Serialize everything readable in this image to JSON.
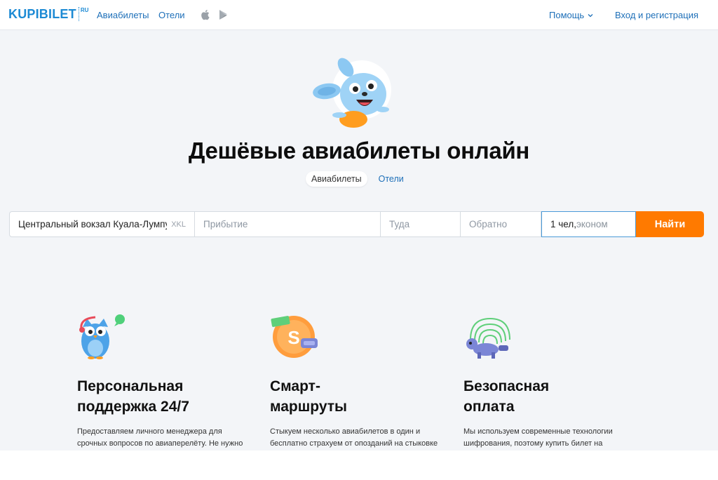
{
  "header": {
    "logo": "KUPIBILET",
    "logo_suffix": "RU",
    "nav": [
      {
        "label": "Авиабилеты"
      },
      {
        "label": "Отели"
      }
    ],
    "help_label": "Помощь",
    "login_label": "Вход и регистрация"
  },
  "hero": {
    "title": "Дешёвые авиабилеты онлайн",
    "tabs": [
      {
        "label": "Авиабилеты",
        "active": true
      },
      {
        "label": "Отели",
        "active": false
      }
    ]
  },
  "search": {
    "from_value": "Центральный вокзал Куала-Лумпур",
    "from_code": "XKL",
    "to_placeholder": "Прибытие",
    "there_placeholder": "Туда",
    "back_placeholder": "Обратно",
    "pax_value": "1 чел,",
    "pax_class": " эконом",
    "submit_label": "Найти"
  },
  "features": [
    {
      "title": "Персональная\nподдержка 24/7",
      "text": "Предоставляем личного менеджера для срочных вопросов по авиаперелёту. Не нужно",
      "icon": "owl-support-icon"
    },
    {
      "title": "Смарт-\nмаршруты",
      "text": "Стыкуем несколько авиабилетов в один и бесплатно страхуем от опозданий на стыковке",
      "icon": "smart-route-icon"
    },
    {
      "title": "Безопасная\nоплата",
      "text": "Мы используем современные технологии шифрования, поэтому купить билет на",
      "icon": "secure-payment-icon"
    }
  ],
  "colors": {
    "brand": "#1c8ad4",
    "link": "#1d6fb8",
    "accent": "#ff7a00",
    "background": "#f3f5f8"
  }
}
